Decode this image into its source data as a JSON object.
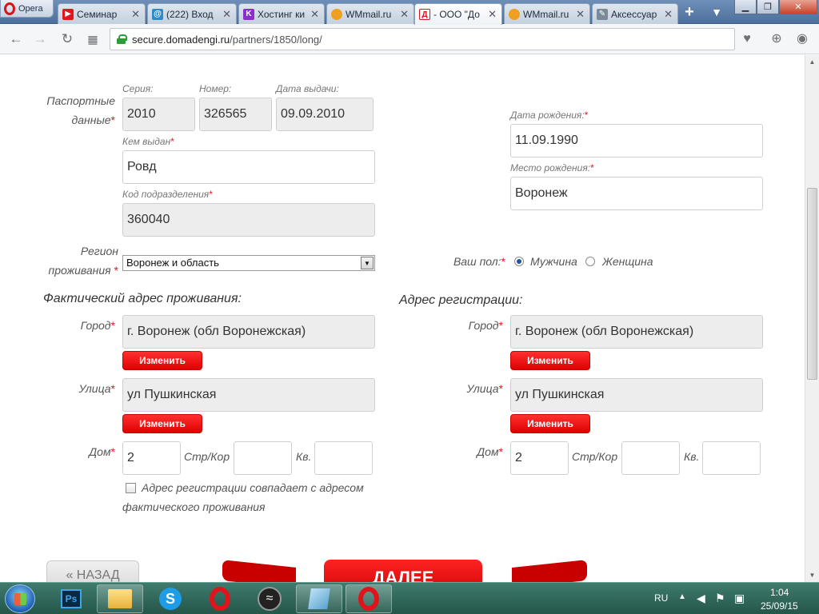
{
  "browser": {
    "menu_label": "Opera",
    "tabs": [
      {
        "title": "Семинар",
        "favicon": "youtube-icon",
        "color": "#e1171e",
        "glyph": "▶"
      },
      {
        "title": "(222) Вход",
        "favicon": "mail-at-icon",
        "color": "#2e8bc9",
        "glyph": "@"
      },
      {
        "title": "Хостинг ки",
        "favicon": "hosting-k-icon",
        "color": "#8a2fc8",
        "glyph": "K"
      },
      {
        "title": "WMmail.ru",
        "favicon": "wmmail-icon",
        "color": "#f0a020",
        "glyph": "●"
      },
      {
        "title": "- ООО \"До",
        "favicon": "domadengi-icon",
        "color": "#d4151b",
        "glyph": "Д"
      },
      {
        "title": "WMmail.ru",
        "favicon": "wmmail-icon",
        "color": "#f0a020",
        "glyph": "●"
      },
      {
        "title": "Аксессуар",
        "favicon": "accessory-icon",
        "color": "#7a8a99",
        "glyph": "✎"
      }
    ],
    "new_tab": "+",
    "url_host": "secure.domadengi.ru",
    "url_path": "/partners/1850/long/"
  },
  "form": {
    "passport": {
      "label": "Паспортные данные",
      "series_label": "Серия:",
      "series_value": "2010",
      "number_label": "Номер:",
      "number_value": "326565",
      "issue_date_label": "Дата выдачи:",
      "issue_date_value": "09.09.2010",
      "issued_by_label": "Кем выдан",
      "issued_by_value": "Ровд",
      "division_code_label": "Код подразделения",
      "division_code_value": "360040"
    },
    "birth": {
      "date_label": "Дата рождения:",
      "date_value": "11.09.1990",
      "place_label": "Место рождения:",
      "place_value": "Воронеж"
    },
    "region": {
      "label": "Регион проживания",
      "value": "Воронеж и область"
    },
    "gender": {
      "label": "Ваш пол:",
      "male": "Мужчина",
      "female": "Женщина",
      "selected": "male"
    },
    "actual_address": {
      "title": "Фактический адрес проживания:",
      "city_label": "Город",
      "city_value": "г. Воронеж (обл Воронежская)",
      "change_label": "Изменить",
      "street_label": "Улица",
      "street_value": "ул Пушкинская",
      "house_label": "Дом",
      "house_value": "2",
      "building_label": "Стр/Кор",
      "building_value": "",
      "apt_label": "Кв.",
      "apt_value": ""
    },
    "registration_address": {
      "title": "Адрес регистрации:",
      "city_label": "Город",
      "city_value": "г. Воронеж (обл Воронежская)",
      "change_label": "Изменить",
      "street_label": "Улица",
      "street_value": "ул Пушкинская",
      "house_label": "Дом",
      "house_value": "2",
      "building_label": "Стр/Кор",
      "building_value": "",
      "apt_label": "Кв.",
      "apt_value": ""
    },
    "same_address_label": "Адрес регистрации совпадает с адресом фактического проживания",
    "required_mark": "*",
    "back_label": "« НАЗАД",
    "next_label": "ДАЛЕЕ"
  },
  "taskbar": {
    "language": "RU",
    "time": "1:04",
    "date": "25/09/15",
    "ps_label": "Ps"
  }
}
